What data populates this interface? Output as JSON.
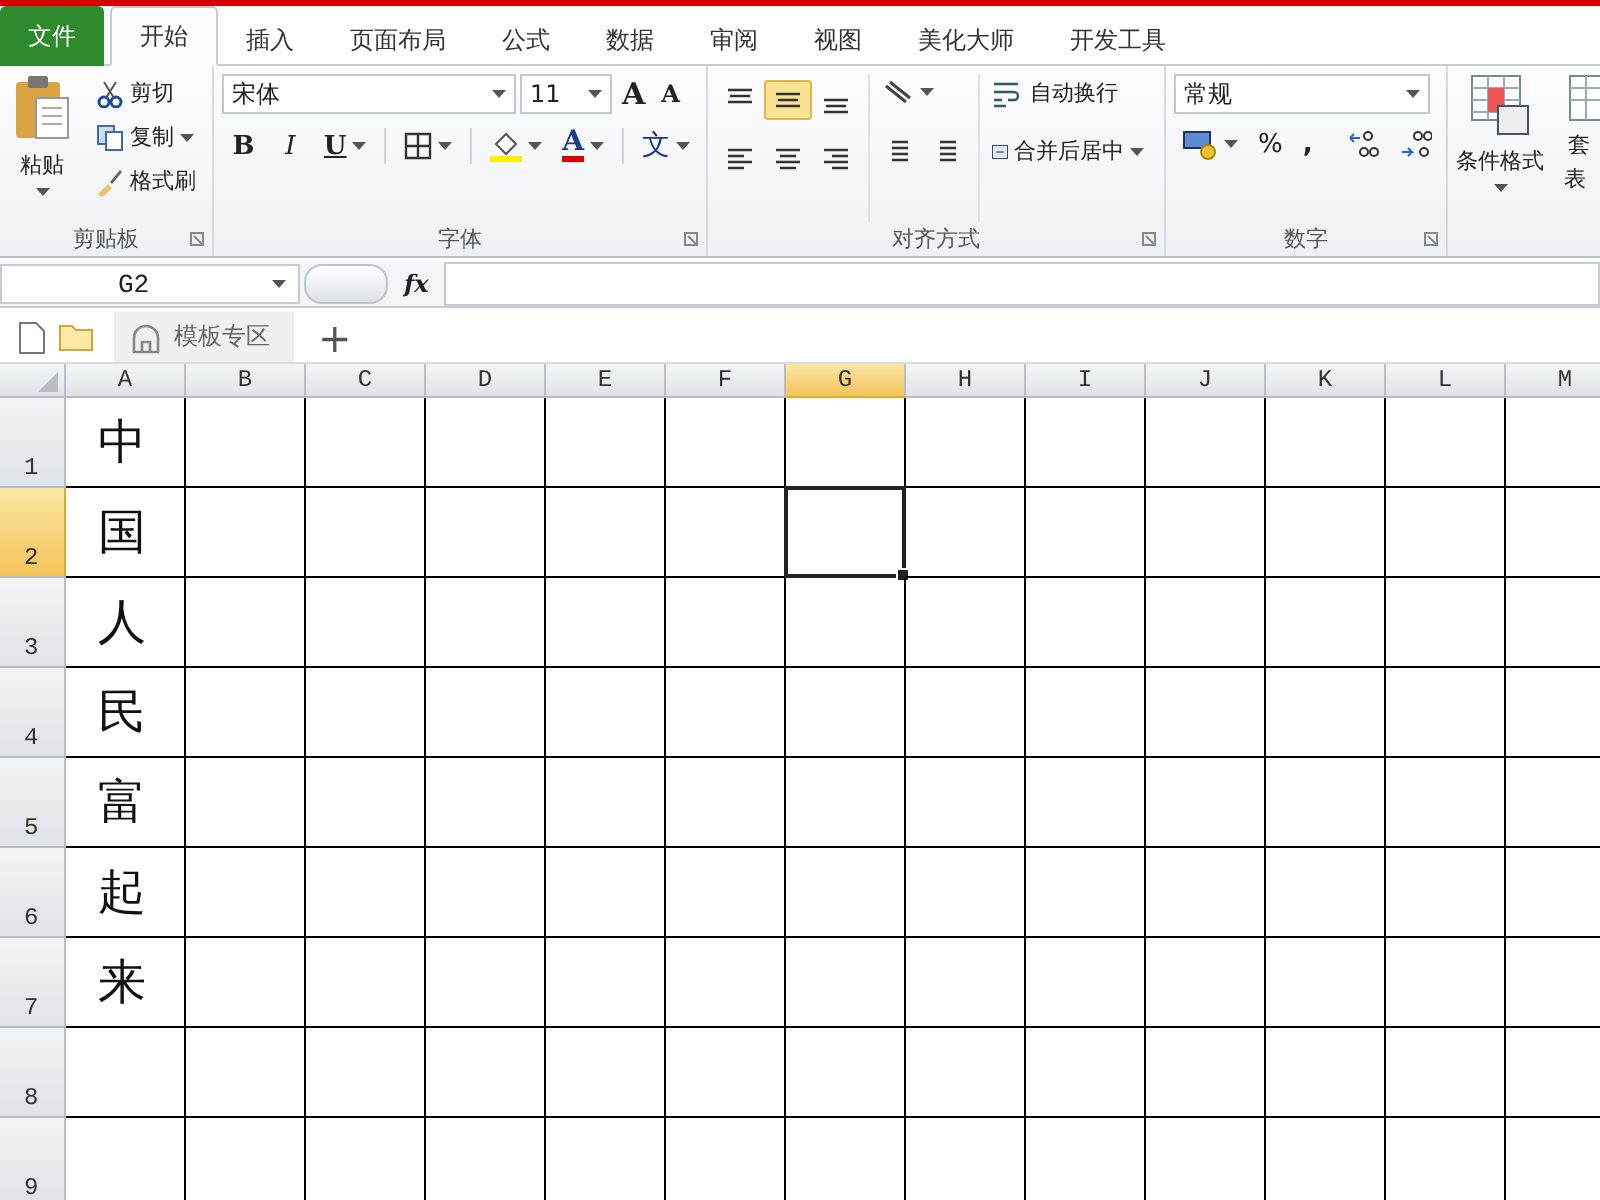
{
  "tabs": [
    {
      "label": "文件",
      "kind": "file",
      "selected": false
    },
    {
      "label": "开始",
      "kind": "tab",
      "selected": true
    },
    {
      "label": "插入",
      "kind": "tab",
      "selected": false
    },
    {
      "label": "页面布局",
      "kind": "tab",
      "selected": false
    },
    {
      "label": "公式",
      "kind": "tab",
      "selected": false
    },
    {
      "label": "数据",
      "kind": "tab",
      "selected": false
    },
    {
      "label": "审阅",
      "kind": "tab",
      "selected": false
    },
    {
      "label": "视图",
      "kind": "tab",
      "selected": false
    },
    {
      "label": "美化大师",
      "kind": "tab",
      "selected": false
    },
    {
      "label": "开发工具",
      "kind": "tab",
      "selected": false
    }
  ],
  "clipboard": {
    "paste": "粘贴",
    "cut": "剪切",
    "copy": "复制",
    "format_painter": "格式刷",
    "label": "剪贴板"
  },
  "font": {
    "name": "宋体",
    "size": "11",
    "grow": "A",
    "shrink": "A",
    "bold": "B",
    "italic": "I",
    "underline": "U",
    "font_color": "A",
    "phonetic": "文",
    "label": "字体"
  },
  "alignment": {
    "middle_selected": true,
    "wrap": "自动换行",
    "merge": "合并后居中",
    "label": "对齐方式"
  },
  "number": {
    "format": "常规",
    "percent": "%",
    "comma": ",",
    "label": "数字"
  },
  "styles": {
    "conditional": "条件格式",
    "table_top": "套",
    "table_bottom": "表"
  },
  "formula_bar": {
    "name_box": "G2",
    "fx": "fx"
  },
  "doc_tabs": {
    "template": "模板专区",
    "add": "+"
  },
  "columns": [
    {
      "label": "A",
      "selected": false
    },
    {
      "label": "B",
      "selected": false
    },
    {
      "label": "C",
      "selected": false
    },
    {
      "label": "D",
      "selected": false
    },
    {
      "label": "E",
      "selected": false
    },
    {
      "label": "F",
      "selected": false
    },
    {
      "label": "G",
      "selected": true
    },
    {
      "label": "H",
      "selected": false
    },
    {
      "label": "I",
      "selected": false
    },
    {
      "label": "J",
      "selected": false
    },
    {
      "label": "K",
      "selected": false
    },
    {
      "label": "L",
      "selected": false
    },
    {
      "label": "M",
      "selected": false
    }
  ],
  "rows": [
    {
      "header": "1",
      "selected": false,
      "first_cell": "中"
    },
    {
      "header": "2",
      "selected": true,
      "first_cell": "国"
    },
    {
      "header": "3",
      "selected": false,
      "first_cell": "人"
    },
    {
      "header": "4",
      "selected": false,
      "first_cell": "民"
    },
    {
      "header": "5",
      "selected": false,
      "first_cell": "富"
    },
    {
      "header": "6",
      "selected": false,
      "first_cell": "起"
    },
    {
      "header": "7",
      "selected": false,
      "first_cell": "来"
    },
    {
      "header": "8",
      "selected": false
    },
    {
      "header": "9",
      "selected": false
    }
  ]
}
